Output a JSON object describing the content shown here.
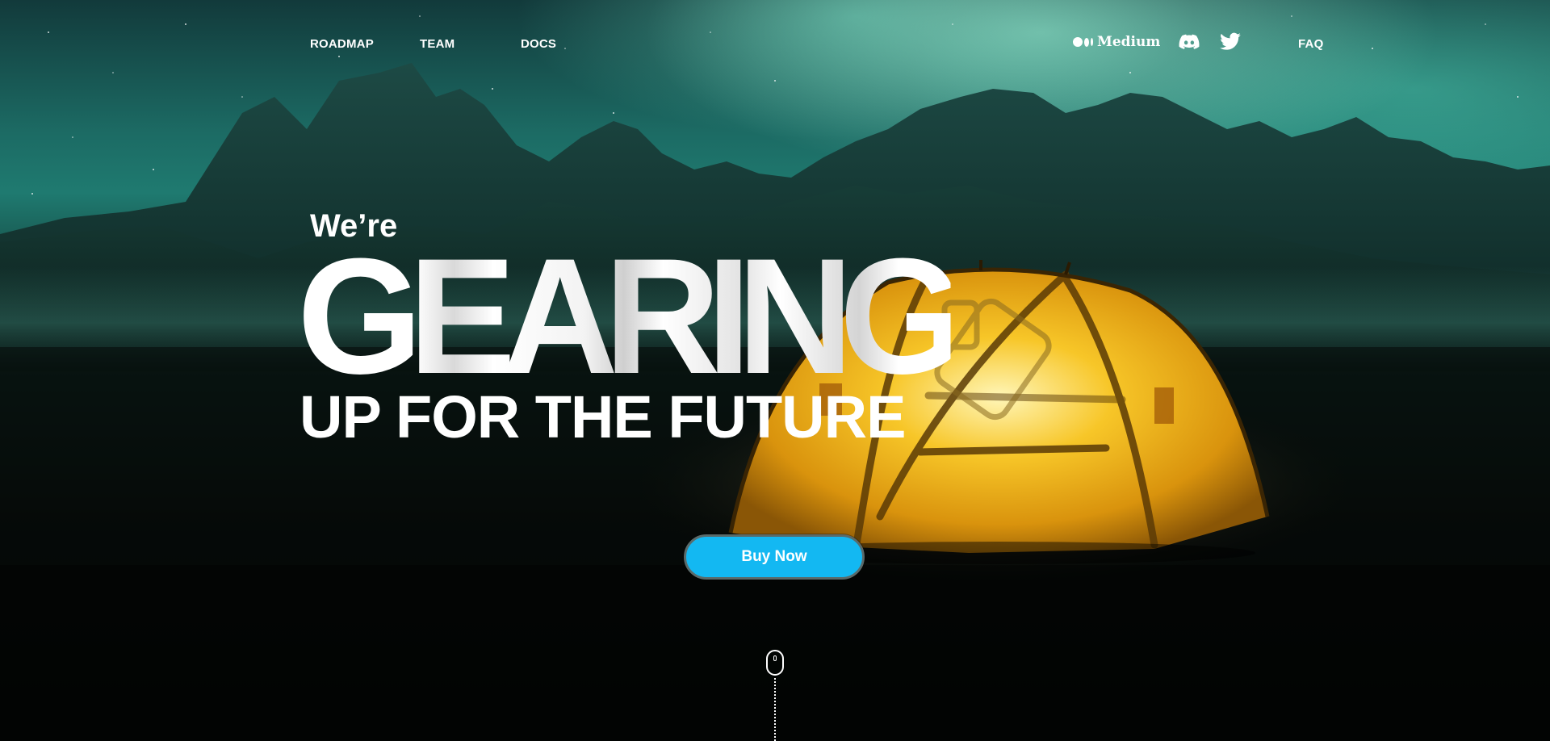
{
  "nav": {
    "roadmap": "ROADMAP",
    "team": "TEAM",
    "docs": "DOCS",
    "faq": "FAQ",
    "medium": "Medium"
  },
  "social": {
    "icons": [
      "medium-icon",
      "discord-icon",
      "twitter-icon"
    ]
  },
  "hero": {
    "intro": "We’re",
    "headline": "GEARING",
    "subheadline": "UP FOR THE FUTURE"
  },
  "cta": {
    "buy_label": "Buy Now",
    "color": "#13b8f2"
  },
  "theme": {
    "tent_color": "#f2b020",
    "aurora_color": "#3fe0b8"
  }
}
